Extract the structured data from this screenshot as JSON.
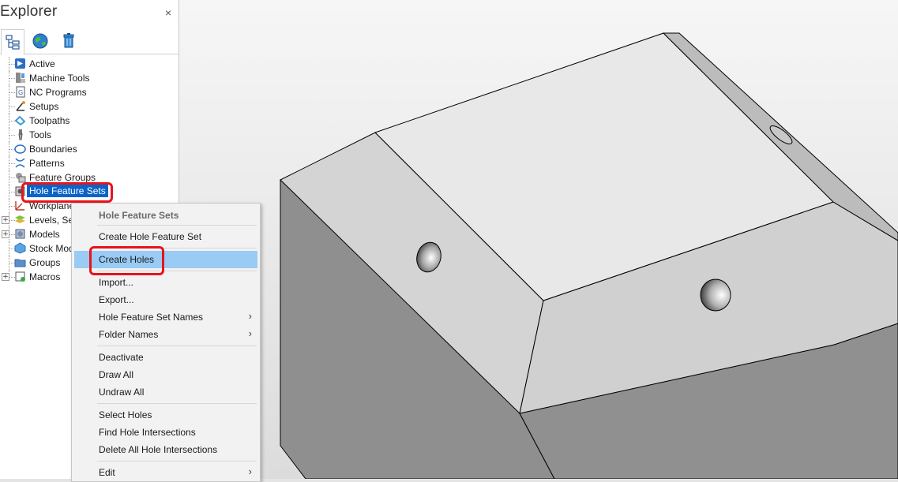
{
  "explorer": {
    "title": "Explorer",
    "close_glyph": "×",
    "tabs": [
      {
        "icon": "tree-view-icon",
        "active": true
      },
      {
        "icon": "globe-icon",
        "active": false
      },
      {
        "icon": "trash-icon",
        "active": false
      }
    ],
    "items": [
      {
        "label": "Active",
        "icon": "active-arrow-icon",
        "expandable": false
      },
      {
        "label": "Machine Tools",
        "icon": "machine-tool-icon",
        "expandable": false
      },
      {
        "label": "NC Programs",
        "icon": "nc-program-icon",
        "expandable": false
      },
      {
        "label": "Setups",
        "icon": "setup-icon",
        "expandable": false
      },
      {
        "label": "Toolpaths",
        "icon": "toolpath-icon",
        "expandable": false
      },
      {
        "label": "Tools",
        "icon": "tool-icon",
        "expandable": false
      },
      {
        "label": "Boundaries",
        "icon": "boundary-icon",
        "expandable": false
      },
      {
        "label": "Patterns",
        "icon": "pattern-icon",
        "expandable": false
      },
      {
        "label": "Feature Groups",
        "icon": "feature-group-icon",
        "expandable": false
      },
      {
        "label": "Hole Feature Sets",
        "icon": "hole-feature-set-icon",
        "expandable": false,
        "selected": true
      },
      {
        "label": "Workplanes",
        "icon": "workplane-icon",
        "expandable": false
      },
      {
        "label": "Levels, Sets",
        "icon": "levels-icon",
        "expandable": true
      },
      {
        "label": "Models",
        "icon": "model-icon",
        "expandable": true
      },
      {
        "label": "Stock Models",
        "icon": "stock-model-icon",
        "expandable": false
      },
      {
        "label": "Groups",
        "icon": "group-folder-icon",
        "expandable": false
      },
      {
        "label": "Macros",
        "icon": "macro-icon",
        "expandable": true
      }
    ]
  },
  "context_menu": {
    "title": "Hole Feature Sets",
    "items": [
      {
        "label": "Create Hole Feature Set",
        "submenu": false
      },
      {
        "label": "Create Holes",
        "submenu": false,
        "hover": true
      },
      {
        "label": "Import...",
        "submenu": false
      },
      {
        "label": "Export...",
        "submenu": false
      },
      {
        "label": "Hole Feature Set Names",
        "submenu": true
      },
      {
        "label": "Folder Names",
        "submenu": true
      },
      {
        "label": "Deactivate",
        "submenu": false
      },
      {
        "label": "Draw All",
        "submenu": false
      },
      {
        "label": "Undraw All",
        "submenu": false
      },
      {
        "label": "Select Holes",
        "submenu": false
      },
      {
        "label": "Find Hole Intersections",
        "submenu": false
      },
      {
        "label": "Delete All Hole Intersections",
        "submenu": false
      },
      {
        "label": "Edit",
        "submenu": true
      }
    ],
    "submenu_arrow": "›"
  },
  "colors": {
    "highlight_box": "#e8131a",
    "selection": "#0a64c8",
    "menu_hover": "#99cbf5",
    "model_top": "#e6e6e6",
    "model_side_light": "#cfcfcf",
    "model_side_dark": "#8c8c8c"
  }
}
